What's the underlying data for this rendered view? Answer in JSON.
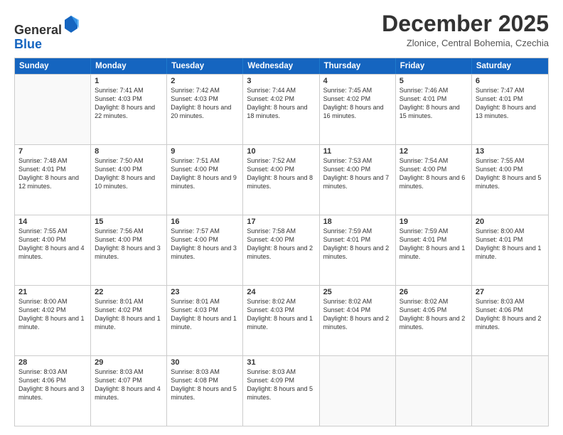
{
  "logo": {
    "general": "General",
    "blue": "Blue"
  },
  "header": {
    "month": "December 2025",
    "location": "Zlonice, Central Bohemia, Czechia"
  },
  "weekdays": [
    "Sunday",
    "Monday",
    "Tuesday",
    "Wednesday",
    "Thursday",
    "Friday",
    "Saturday"
  ],
  "rows": [
    [
      {
        "day": "",
        "text": ""
      },
      {
        "day": "1",
        "text": "Sunrise: 7:41 AM\nSunset: 4:03 PM\nDaylight: 8 hours and 22 minutes."
      },
      {
        "day": "2",
        "text": "Sunrise: 7:42 AM\nSunset: 4:03 PM\nDaylight: 8 hours and 20 minutes."
      },
      {
        "day": "3",
        "text": "Sunrise: 7:44 AM\nSunset: 4:02 PM\nDaylight: 8 hours and 18 minutes."
      },
      {
        "day": "4",
        "text": "Sunrise: 7:45 AM\nSunset: 4:02 PM\nDaylight: 8 hours and 16 minutes."
      },
      {
        "day": "5",
        "text": "Sunrise: 7:46 AM\nSunset: 4:01 PM\nDaylight: 8 hours and 15 minutes."
      },
      {
        "day": "6",
        "text": "Sunrise: 7:47 AM\nSunset: 4:01 PM\nDaylight: 8 hours and 13 minutes."
      }
    ],
    [
      {
        "day": "7",
        "text": "Sunrise: 7:48 AM\nSunset: 4:01 PM\nDaylight: 8 hours and 12 minutes."
      },
      {
        "day": "8",
        "text": "Sunrise: 7:50 AM\nSunset: 4:00 PM\nDaylight: 8 hours and 10 minutes."
      },
      {
        "day": "9",
        "text": "Sunrise: 7:51 AM\nSunset: 4:00 PM\nDaylight: 8 hours and 9 minutes."
      },
      {
        "day": "10",
        "text": "Sunrise: 7:52 AM\nSunset: 4:00 PM\nDaylight: 8 hours and 8 minutes."
      },
      {
        "day": "11",
        "text": "Sunrise: 7:53 AM\nSunset: 4:00 PM\nDaylight: 8 hours and 7 minutes."
      },
      {
        "day": "12",
        "text": "Sunrise: 7:54 AM\nSunset: 4:00 PM\nDaylight: 8 hours and 6 minutes."
      },
      {
        "day": "13",
        "text": "Sunrise: 7:55 AM\nSunset: 4:00 PM\nDaylight: 8 hours and 5 minutes."
      }
    ],
    [
      {
        "day": "14",
        "text": "Sunrise: 7:55 AM\nSunset: 4:00 PM\nDaylight: 8 hours and 4 minutes."
      },
      {
        "day": "15",
        "text": "Sunrise: 7:56 AM\nSunset: 4:00 PM\nDaylight: 8 hours and 3 minutes."
      },
      {
        "day": "16",
        "text": "Sunrise: 7:57 AM\nSunset: 4:00 PM\nDaylight: 8 hours and 3 minutes."
      },
      {
        "day": "17",
        "text": "Sunrise: 7:58 AM\nSunset: 4:00 PM\nDaylight: 8 hours and 2 minutes."
      },
      {
        "day": "18",
        "text": "Sunrise: 7:59 AM\nSunset: 4:01 PM\nDaylight: 8 hours and 2 minutes."
      },
      {
        "day": "19",
        "text": "Sunrise: 7:59 AM\nSunset: 4:01 PM\nDaylight: 8 hours and 1 minute."
      },
      {
        "day": "20",
        "text": "Sunrise: 8:00 AM\nSunset: 4:01 PM\nDaylight: 8 hours and 1 minute."
      }
    ],
    [
      {
        "day": "21",
        "text": "Sunrise: 8:00 AM\nSunset: 4:02 PM\nDaylight: 8 hours and 1 minute."
      },
      {
        "day": "22",
        "text": "Sunrise: 8:01 AM\nSunset: 4:02 PM\nDaylight: 8 hours and 1 minute."
      },
      {
        "day": "23",
        "text": "Sunrise: 8:01 AM\nSunset: 4:03 PM\nDaylight: 8 hours and 1 minute."
      },
      {
        "day": "24",
        "text": "Sunrise: 8:02 AM\nSunset: 4:03 PM\nDaylight: 8 hours and 1 minute."
      },
      {
        "day": "25",
        "text": "Sunrise: 8:02 AM\nSunset: 4:04 PM\nDaylight: 8 hours and 2 minutes."
      },
      {
        "day": "26",
        "text": "Sunrise: 8:02 AM\nSunset: 4:05 PM\nDaylight: 8 hours and 2 minutes."
      },
      {
        "day": "27",
        "text": "Sunrise: 8:03 AM\nSunset: 4:06 PM\nDaylight: 8 hours and 2 minutes."
      }
    ],
    [
      {
        "day": "28",
        "text": "Sunrise: 8:03 AM\nSunset: 4:06 PM\nDaylight: 8 hours and 3 minutes."
      },
      {
        "day": "29",
        "text": "Sunrise: 8:03 AM\nSunset: 4:07 PM\nDaylight: 8 hours and 4 minutes."
      },
      {
        "day": "30",
        "text": "Sunrise: 8:03 AM\nSunset: 4:08 PM\nDaylight: 8 hours and 5 minutes."
      },
      {
        "day": "31",
        "text": "Sunrise: 8:03 AM\nSunset: 4:09 PM\nDaylight: 8 hours and 5 minutes."
      },
      {
        "day": "",
        "text": ""
      },
      {
        "day": "",
        "text": ""
      },
      {
        "day": "",
        "text": ""
      }
    ]
  ]
}
